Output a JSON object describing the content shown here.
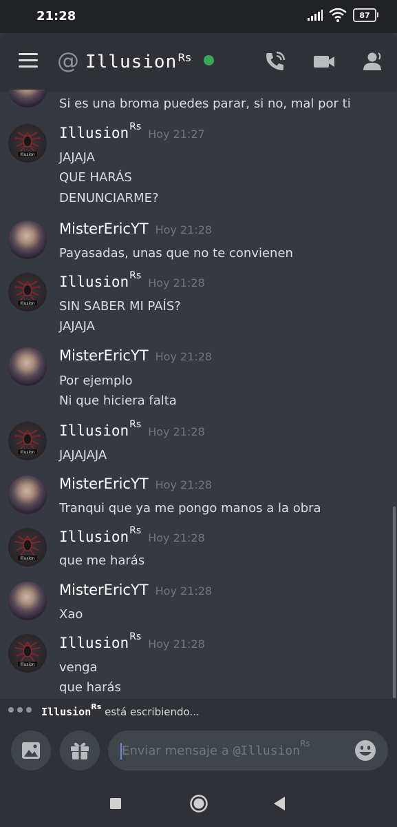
{
  "status_bar": {
    "time": "21:28",
    "battery": "87"
  },
  "header": {
    "at_symbol": "@",
    "channel_name": "Illusion",
    "channel_suffix": "Rs"
  },
  "messages": [
    {
      "author": "MisterEricYT",
      "author_suffix": "",
      "time": "",
      "lines": [
        "Si es una broma puedes parar, si no, mal por ti"
      ],
      "partial": true
    },
    {
      "author": "Illusion",
      "author_suffix": "Rs",
      "time": "Hoy 21:27",
      "lines": [
        "JAJAJA",
        "QUE HARÁS",
        "DENUNCIARME?"
      ]
    },
    {
      "author": "MisterEricYT",
      "author_suffix": "",
      "time": "Hoy 21:28",
      "lines": [
        "Payasadas, unas que no te convienen"
      ]
    },
    {
      "author": "Illusion",
      "author_suffix": "Rs",
      "time": "Hoy 21:28",
      "lines": [
        "SIN SABER MI PAÍS?",
        "JAJAJA"
      ]
    },
    {
      "author": "MisterEricYT",
      "author_suffix": "",
      "time": "Hoy 21:28",
      "lines": [
        "Por ejemplo",
        "Ni que hiciera falta"
      ]
    },
    {
      "author": "Illusion",
      "author_suffix": "Rs",
      "time": "Hoy 21:28",
      "lines": [
        "JAJAJAJA"
      ]
    },
    {
      "author": "MisterEricYT",
      "author_suffix": "",
      "time": "Hoy 21:28",
      "lines": [
        "Tranqui que ya me pongo manos a la obra"
      ]
    },
    {
      "author": "Illusion",
      "author_suffix": "Rs",
      "time": "Hoy 21:28",
      "lines": [
        "que me harás"
      ]
    },
    {
      "author": "MisterEricYT",
      "author_suffix": "",
      "time": "Hoy 21:28",
      "lines": [
        "Xao"
      ]
    },
    {
      "author": "Illusion",
      "author_suffix": "Rs",
      "time": "Hoy 21:28",
      "lines": [
        "venga",
        "que harás"
      ]
    }
  ],
  "typing": {
    "name": "Illusion",
    "suffix": "Rs",
    "text": "está escribiendo..."
  },
  "composer": {
    "placeholder": "Enviar mensaje a ",
    "placeholder_at": "@Illusion",
    "placeholder_suffix": "Rs"
  },
  "icons": {
    "menu": "hamburger-menu-icon",
    "call": "phone-call-icon",
    "video": "video-camera-icon",
    "members": "member-list-icon",
    "image": "image-upload-icon",
    "gift": "gift-icon",
    "emoji": "emoji-icon",
    "nav_recent": "square-icon",
    "nav_home": "circle-icon",
    "nav_back": "triangle-back-icon"
  },
  "colors": {
    "online": "#3ba55c",
    "accent": "#7289da",
    "background": "#36393f"
  }
}
